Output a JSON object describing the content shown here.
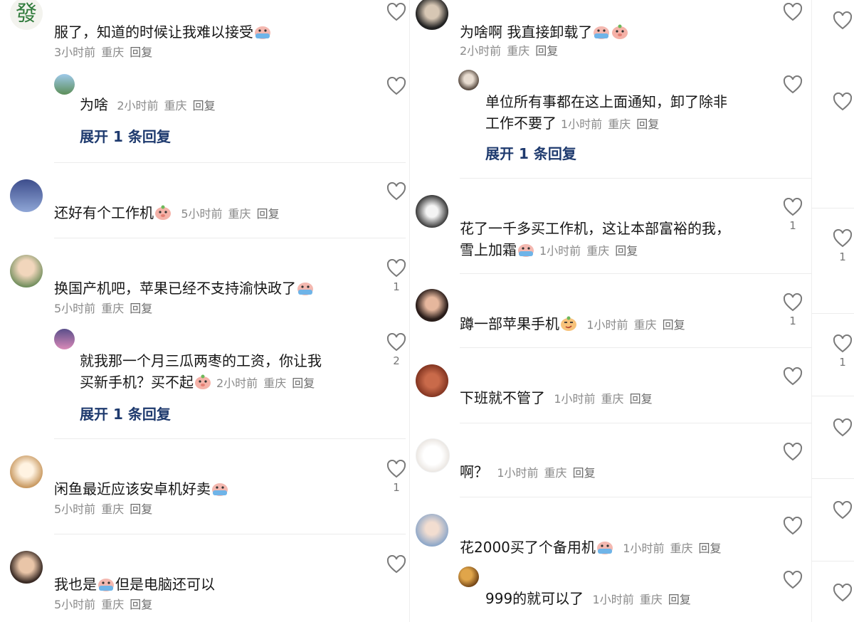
{
  "col1": {
    "comments": [
      {
        "text": "服了，知道的时候让我难以接受",
        "emoji": "crying-face-emoji",
        "time": "3小时前",
        "location": "重庆",
        "reply": "回复",
        "likes": "",
        "avatar": "fa-character-avatar",
        "avatar_char": "發"
      },
      {
        "text": "为啥",
        "time": "2小时前",
        "location": "重庆",
        "reply": "回复",
        "likes": "",
        "expand": "展开 1 条回复"
      },
      {
        "text": "还好有个工作机",
        "emoji": "pig-face-emoji",
        "time": "5小时前",
        "location": "重庆",
        "reply": "回复",
        "likes": ""
      },
      {
        "text": "换国产机吧，苹果已经不支持渝快政了",
        "emoji": "crying-face-emoji",
        "time": "5小时前",
        "location": "重庆",
        "reply": "回复",
        "likes": "1"
      },
      {
        "text1": "就我那一个月三瓜两枣的工资，你让我",
        "text2": "买新手机？买不起",
        "emoji": "pig-face-emoji",
        "time": "2小时前",
        "location": "重庆",
        "reply": "回复",
        "likes": "2",
        "expand": "展开 1 条回复"
      },
      {
        "text": "闲鱼最近应该安卓机好卖",
        "emoji": "crying-face-emoji",
        "time": "5小时前",
        "location": "重庆",
        "reply": "回复",
        "likes": "1"
      },
      {
        "text_a": "我也是",
        "text_b": "但是电脑还可以",
        "emoji": "crying-face-emoji",
        "time": "5小时前",
        "location": "重庆",
        "reply": "回复",
        "likes": ""
      }
    ]
  },
  "col2": {
    "comments": [
      {
        "text": "为啥啊 我直接卸载了",
        "emoji": "crying-face-emoji",
        "time": "2小时前",
        "location": "重庆",
        "reply": "回复",
        "likes": ""
      },
      {
        "text1": "单位所有事都在这上面通知，卸了除非",
        "text2": "工作不要了",
        "time": "1小时前",
        "location": "重庆",
        "reply": "回复",
        "likes": "",
        "expand": "展开 1 条回复"
      },
      {
        "text1": "花了一千多买工作机，这让本部富裕的我，",
        "text2": "雪上加霜",
        "emoji": "crying-face-emoji",
        "time": "1小时前",
        "location": "重庆",
        "reply": "回复",
        "likes": "1"
      },
      {
        "text": "蹲一部苹果手机",
        "emoji": "smirk-face-emoji",
        "time": "1小时前",
        "location": "重庆",
        "reply": "回复",
        "likes": "1"
      },
      {
        "text": "下班就不管了",
        "time": "1小时前",
        "location": "重庆",
        "reply": "回复",
        "likes": ""
      },
      {
        "text": "啊？",
        "time": "1小时前",
        "location": "重庆",
        "reply": "回复",
        "likes": ""
      },
      {
        "text": "花2000买了个备用机",
        "emoji": "crying-face-emoji",
        "time": "1小时前",
        "location": "重庆",
        "reply": "回复",
        "likes": ""
      },
      {
        "text": "999的就可以了",
        "time": "1小时前",
        "location": "重庆",
        "reply": "回复",
        "likes": ""
      }
    ]
  },
  "col3": {
    "likes": [
      "",
      "",
      "1",
      "1",
      "",
      "",
      ""
    ]
  }
}
